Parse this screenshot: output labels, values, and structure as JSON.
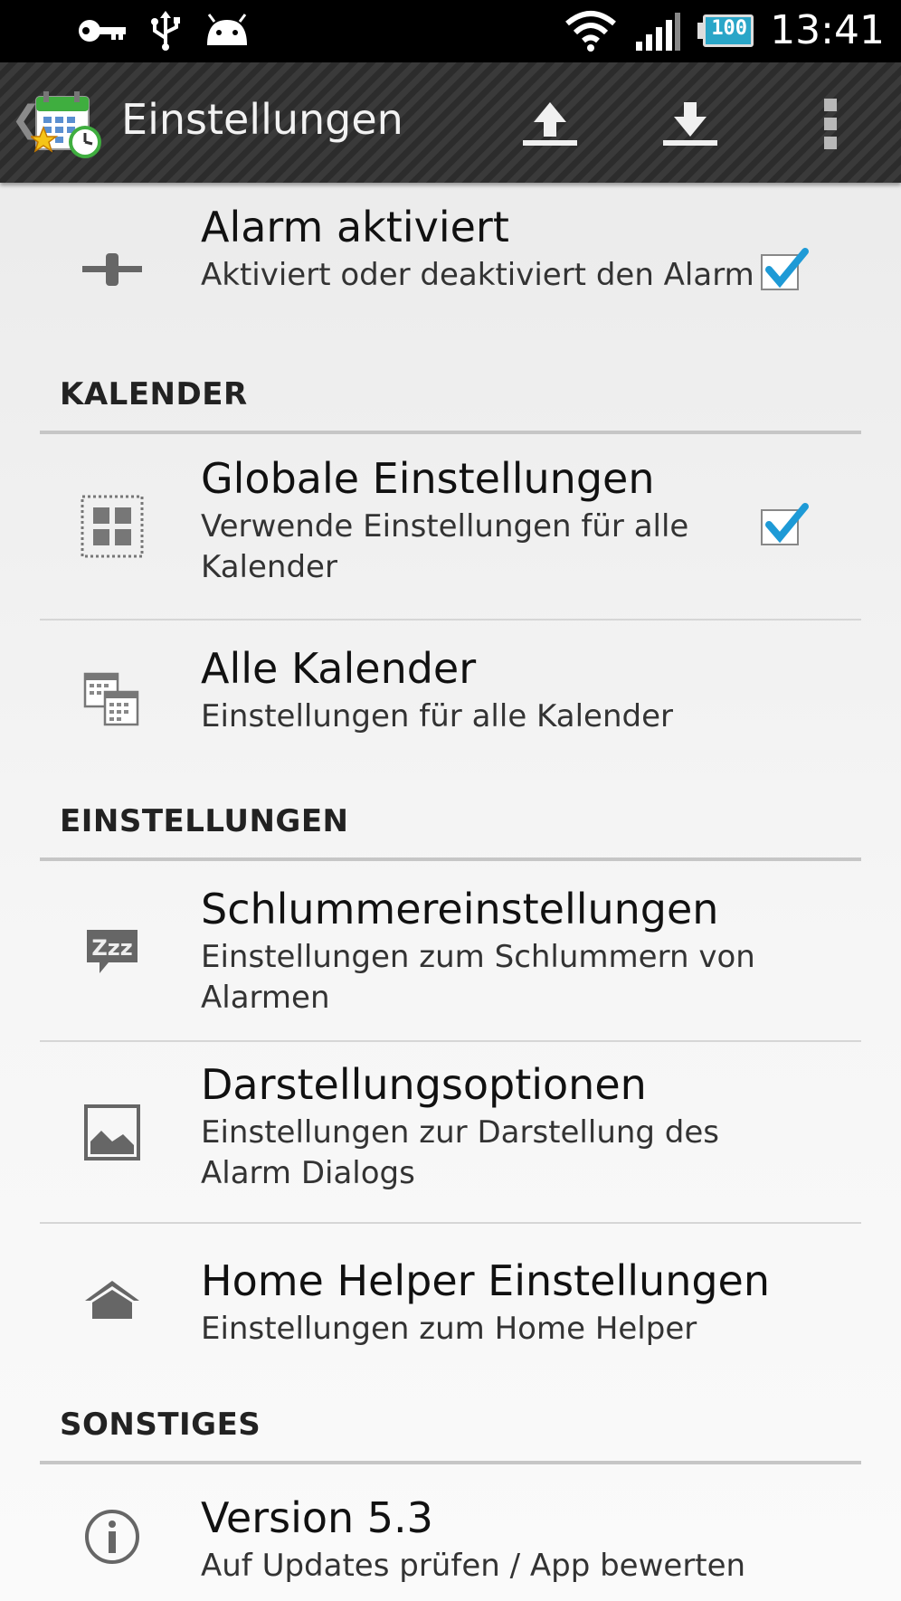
{
  "status_bar": {
    "time": "13:41",
    "battery_level": "100",
    "icons": [
      "key-icon",
      "usb-icon",
      "android-icon",
      "wifi-icon",
      "signal-icon",
      "battery-icon"
    ]
  },
  "action_bar": {
    "title": "Einstellungen",
    "icons": [
      "back-chevron-icon",
      "app-calendar-icon",
      "upload-icon",
      "download-icon",
      "overflow-menu-icon"
    ]
  },
  "preferences": {
    "alarm": {
      "title": "Alarm aktiviert",
      "summary": "Aktiviert oder deaktiviert den Alarm",
      "checked": true,
      "icon": "switch-icon"
    },
    "calendar_section": "KALENDER",
    "global": {
      "title": "Globale Einstellungen",
      "summary": "Verwende Einstellungen für alle Kalender",
      "checked": true,
      "icon": "grid-icon"
    },
    "all_calendars": {
      "title": "Alle Kalender",
      "summary": "Einstellungen für alle Kalender",
      "icon": "calendars-icon"
    },
    "settings_section": "EINSTELLUNGEN",
    "snooze": {
      "title": "Schlummereinstellungen",
      "summary": "Einstellungen zum Schlummern von Alarmen",
      "icon": "zzz-icon"
    },
    "display": {
      "title": "Darstellungsoptionen",
      "summary": "Einstellungen zur Darstellung des Alarm Dialogs",
      "icon": "image-icon"
    },
    "home_helper": {
      "title": "Home Helper Einstellungen",
      "summary": "Einstellungen zum Home Helper",
      "icon": "home-icon"
    },
    "other_section": "SONSTIGES",
    "version": {
      "title": "Version 5.3",
      "summary": "Auf Updates prüfen / App bewerten",
      "icon": "info-icon"
    }
  },
  "colors": {
    "check_blue": "#1e9ad6",
    "icon_gray": "#666666",
    "divider": "#d6d6d6"
  }
}
